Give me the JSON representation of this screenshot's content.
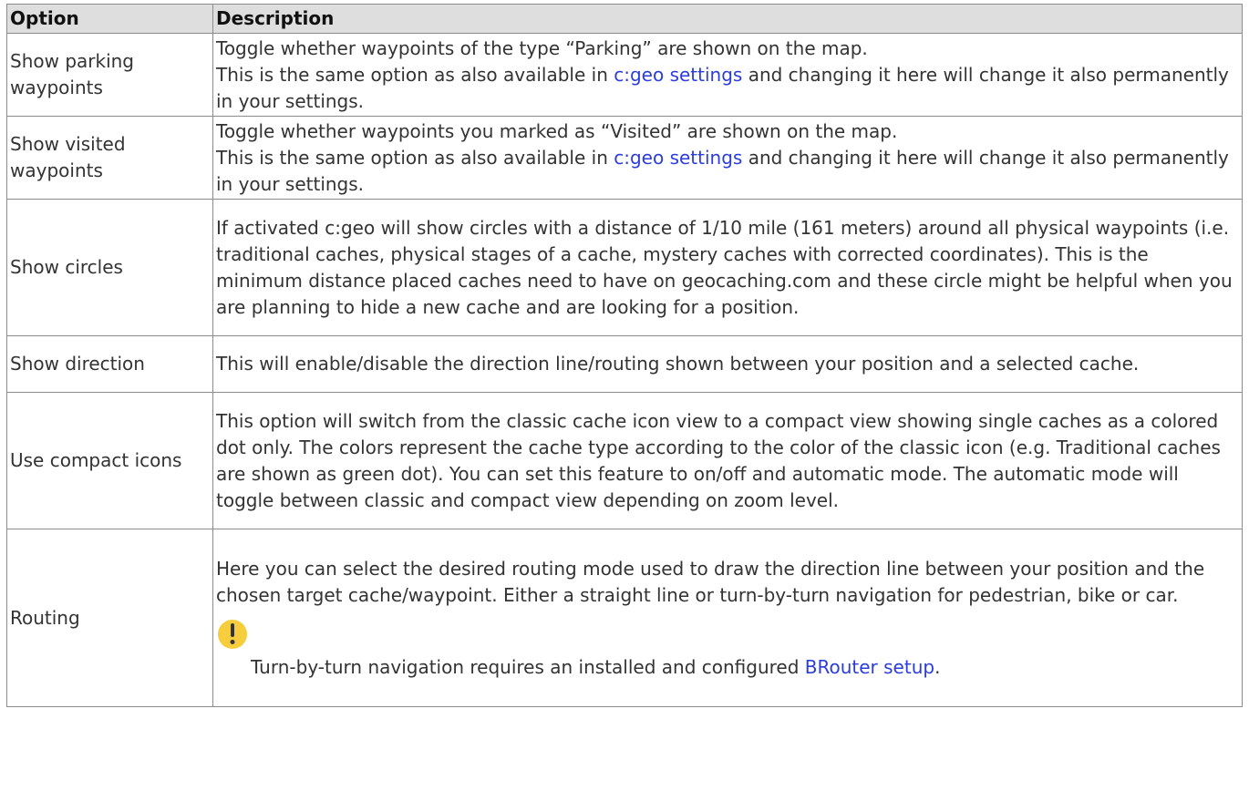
{
  "table": {
    "headers": {
      "option": "Option",
      "description": "Description"
    },
    "rows": [
      {
        "option": "Show parking waypoints",
        "line1": "Toggle whether waypoints of the type “Parking” are shown on the map.",
        "line2_before": "This is the same option as also available in ",
        "link": "c:geo settings",
        "line2_after": " and changing it here will change it also permanently in your settings."
      },
      {
        "option": "Show visited waypoints",
        "line1": "Toggle whether waypoints you marked as “Visited” are shown on the map.",
        "line2_before": "This is the same option as also available in ",
        "link": "c:geo settings",
        "line2_after": " and changing it here will change it also permanently in your settings."
      },
      {
        "option": "Show circles",
        "text": "If activated c:geo will show circles with a distance of 1/10 mile (161 meters) around all physical waypoints (i.e. traditional caches, physical stages of a cache, mystery caches with corrected coordinates). This is the minimum distance placed caches need to have on geocaching.com and these circle might be helpful when you are planning to hide a new cache and are looking for a position."
      },
      {
        "option": "Show direction",
        "text": "This will enable/disable the direction line/routing shown between your position and a selected cache."
      },
      {
        "option": "Use compact icons",
        "text": "This option will switch from the classic cache icon view to a compact view showing single caches as a colored dot only. The colors represent the cache type according to the color of the classic icon (e.g. Traditional caches are shown as green dot). You can set this feature to on/off and automatic mode. The automatic mode will toggle between classic and compact view depending on zoom level."
      },
      {
        "option": "Routing",
        "text": "Here you can select the desired routing mode used to draw the direction line between your position and the chosen target cache/waypoint. Either a straight line or turn-by-turn navigation for pedestrian, bike or car.",
        "note_before": "Turn-by-turn navigation requires an installed and configured ",
        "note_link": "BRouter setup",
        "note_after": ".",
        "note_icon": "exclamation-icon"
      }
    ]
  },
  "colors": {
    "link": "#2b3ce0",
    "note_icon": "#f6cd3c",
    "header_bg": "#dedede",
    "border": "#8c8c8c"
  }
}
